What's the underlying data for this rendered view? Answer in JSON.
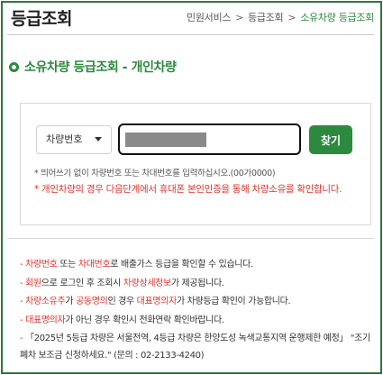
{
  "header": {
    "title": "등급조회",
    "breadcrumb": [
      "민원서비스",
      "등급조회",
      "소유차량 등급조회"
    ],
    "separator": ">"
  },
  "section": {
    "title": "소유차량 등급조회 - 개인차량"
  },
  "search": {
    "select_value": "차량번호",
    "find_label": "찾기",
    "hint": "* 띄어쓰기 없이 차량번호 또는 차대번호를 입력하십시오.(00가0000)",
    "warning": "* 개인차량의 경우 다음단계에서 휴대폰 본인인증을 통해 차량소유를 확인합니다."
  },
  "notices": {
    "n1": {
      "dash": "- ",
      "a": "차량번호",
      "b": " 또는 ",
      "c": "차대번호",
      "d": "로 배출가스 등급을 확인할 수 있습니다."
    },
    "n2": {
      "dash": "- ",
      "a": "회원",
      "b": "으로 로그인 후 조회시 ",
      "c": "차량상세정보",
      "d": "가 제공됩니다."
    },
    "n3": {
      "dash": "- ",
      "a": "차량소유주",
      "b": "가 ",
      "c": "공동명의",
      "d": "인 경우 ",
      "e": "대표명의자",
      "f": "가 차량등급 확인이 가능합니다."
    },
    "n4": {
      "dash": "- ",
      "a": "대표명의자",
      "b": "가 아닌 경우 확인시 전화연락 확인바랍니다."
    },
    "n5": {
      "dash": "- ",
      "text": "「2025년 5등급 차량은 서울전역, 4등급 차량은 한양도성 녹색교통지역 운행제한 예정」 \"조기폐차 보조금 신청하세요.\" (문의 : 02-2133-4240)"
    }
  },
  "colors": {
    "accent": "#2b8a3e",
    "warning": "#e0342b",
    "border": "#2b7a3b"
  }
}
